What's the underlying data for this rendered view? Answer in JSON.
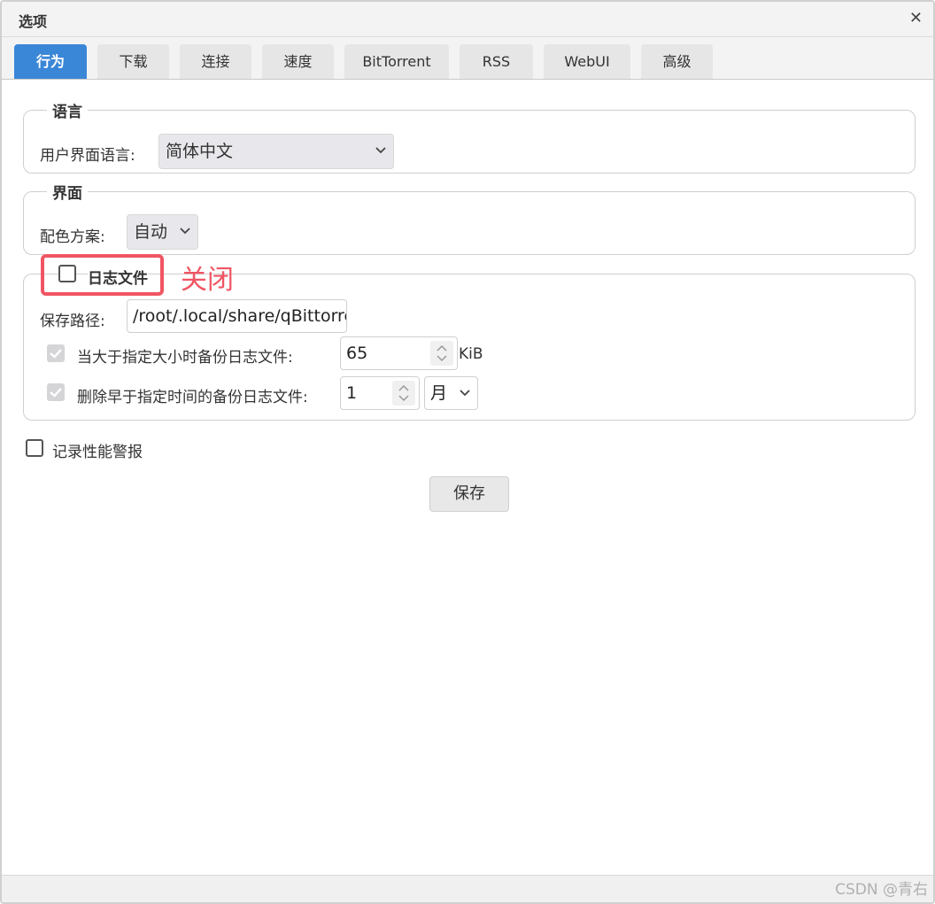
{
  "window": {
    "title": "选项",
    "close_symbol": "✕"
  },
  "tabs": [
    {
      "label": "行为",
      "active": true
    },
    {
      "label": "下载",
      "active": false
    },
    {
      "label": "连接",
      "active": false
    },
    {
      "label": "速度",
      "active": false
    },
    {
      "label": "BitTorrent",
      "active": false
    },
    {
      "label": "RSS",
      "active": false
    },
    {
      "label": "WebUI",
      "active": false
    },
    {
      "label": "高级",
      "active": false
    }
  ],
  "language": {
    "legend": "语言",
    "ui_language_label": "用户界面语言:",
    "ui_language_value": "简体中文"
  },
  "interface": {
    "legend": "界面",
    "color_scheme_label": "配色方案:",
    "color_scheme_value": "自动"
  },
  "log_file": {
    "legend": "日志文件",
    "enabled": false,
    "save_path_label": "保存路径:",
    "save_path_value": "/root/.local/share/qBittorre",
    "backup_label": "当大于指定大小时备份日志文件:",
    "backup_checked": true,
    "backup_size_value": "65",
    "backup_size_unit": "KiB",
    "delete_label": "删除早于指定时间的备份日志文件:",
    "delete_checked": true,
    "delete_age_value": "1",
    "delete_age_unit": "月"
  },
  "performance_warning": {
    "label": "记录性能警报",
    "checked": false
  },
  "save_button": "保存",
  "annotation": {
    "text": "关闭",
    "color": "#f05563"
  },
  "watermark": "CSDN @青右",
  "colors": {
    "accent": "#3a87d8",
    "annotation": "#f05563"
  }
}
